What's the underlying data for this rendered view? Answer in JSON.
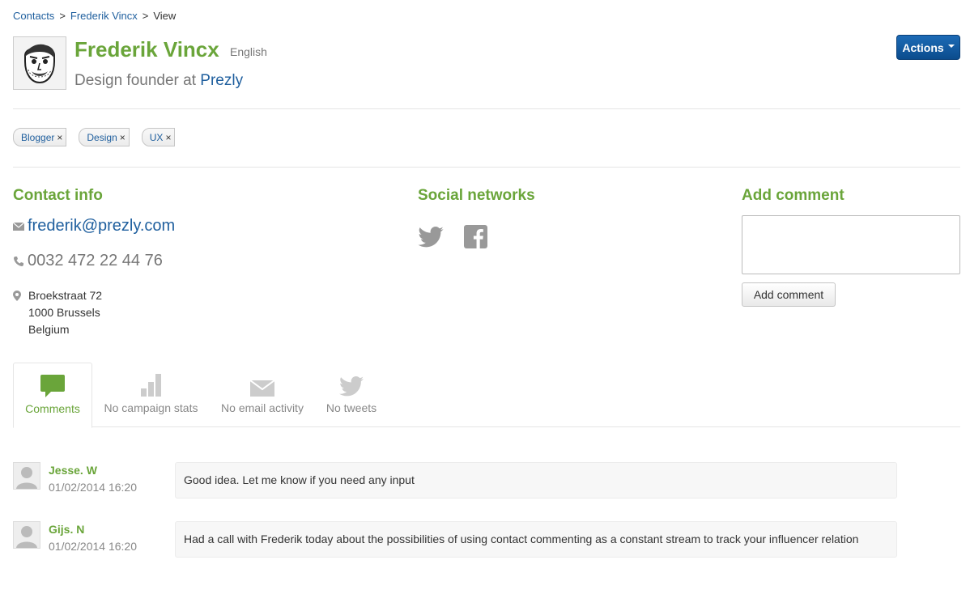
{
  "breadcrumb": {
    "items": [
      "Contacts",
      "Frederik Vincx",
      "View"
    ],
    "separator": ">"
  },
  "contact": {
    "name": "Frederik Vincx",
    "language": "English",
    "job_prefix": "Design founder at",
    "company": "Prezly"
  },
  "actions": {
    "label": "Actions"
  },
  "tags": [
    {
      "label": "Blogger",
      "remove": "×"
    },
    {
      "label": "Design",
      "remove": "×"
    },
    {
      "label": "UX",
      "remove": "×"
    }
  ],
  "contact_info": {
    "title": "Contact info",
    "email": "frederik@prezly.com",
    "phone": "0032 472 22 44 76",
    "address": [
      "Broekstraat 72",
      "1000 Brussels",
      "Belgium"
    ]
  },
  "social": {
    "title": "Social networks",
    "icons": [
      "twitter-icon",
      "facebook-icon"
    ]
  },
  "add_comment": {
    "title": "Add comment",
    "textarea_value": "",
    "button_label": "Add comment"
  },
  "tabs": [
    {
      "label": "Comments",
      "icon": "comment-icon",
      "active": true
    },
    {
      "label": "No campaign stats",
      "icon": "bar-chart-icon",
      "active": false
    },
    {
      "label": "No email activity",
      "icon": "envelope-icon",
      "active": false
    },
    {
      "label": "No tweets",
      "icon": "twitter-icon",
      "active": false
    }
  ],
  "comments": [
    {
      "author": "Jesse. W",
      "date": "01/02/2014 16:20",
      "text": "Good idea. Let me know if you need any input"
    },
    {
      "author": "Gijs. N",
      "date": "01/02/2014 16:20",
      "text": "Had a call with Frederik today about the possibilities of using contact commenting as a constant stream to track your influencer relation"
    }
  ],
  "colors": {
    "accent_green": "#6aa53a",
    "link_blue": "#1f5f9e",
    "primary_button": "#0b4c8d",
    "muted_gray": "#777777"
  }
}
